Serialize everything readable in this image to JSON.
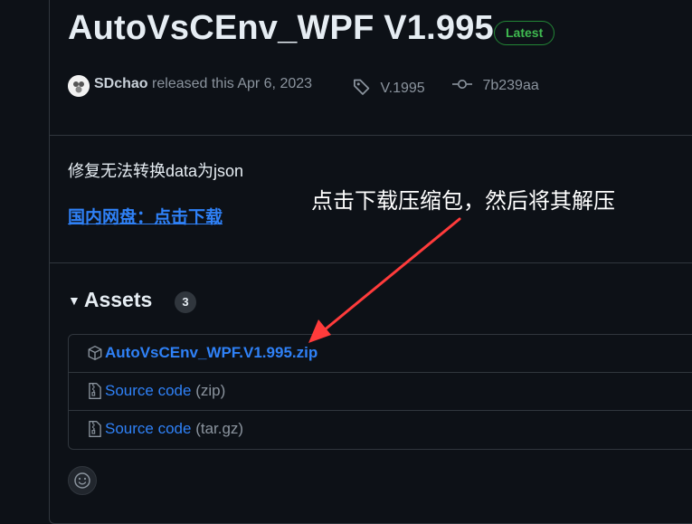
{
  "release": {
    "title": "AutoVsCEnv_WPF V1.995",
    "badge": "Latest",
    "author": "SDchao",
    "released_text": "released this Apr 6, 2023",
    "tag": "V.1995",
    "commit": "7b239aa"
  },
  "body": {
    "note": "修复无法转换data为json",
    "mirror_link": "国内网盘：点击下载"
  },
  "annotation": {
    "text": "点击下载压缩包，然后将其解压",
    "color": "#ff3b3b"
  },
  "assets": {
    "heading": "Assets",
    "count": "3",
    "items": [
      {
        "name": "AutoVsCEnv_WPF.V1.995.zip",
        "ext": "",
        "icon": "package-icon"
      },
      {
        "name": "Source code",
        "ext": "(zip)",
        "icon": "file-zip-icon"
      },
      {
        "name": "Source code",
        "ext": "(tar.gz)",
        "icon": "file-zip-icon"
      }
    ]
  },
  "colors": {
    "background": "#0d1117",
    "link": "#2f81f7",
    "badge": "#3fb950"
  }
}
